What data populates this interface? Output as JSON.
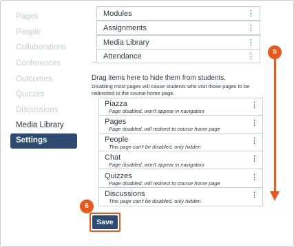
{
  "sidebar": {
    "items": [
      {
        "label": "Pages"
      },
      {
        "label": "People"
      },
      {
        "label": "Collaborations"
      },
      {
        "label": "Conferences"
      },
      {
        "label": "Outcomes"
      },
      {
        "label": "Quizzes"
      },
      {
        "label": "Discussions"
      },
      {
        "label": "Media Library"
      },
      {
        "label": "Settings"
      }
    ]
  },
  "enabled_items": [
    {
      "label": "Modules"
    },
    {
      "label": "Assignments"
    },
    {
      "label": "Media Library"
    },
    {
      "label": "Attendance"
    }
  ],
  "drag_hint": "Drag items here to hide them from students.",
  "drag_hint_small": "Disabling most pages will cause students who visit those pages to be redirected to the course home page.",
  "disabled_items": [
    {
      "name": "Piazza",
      "sub": "Page disabled, won't appear in navigation"
    },
    {
      "name": "Pages",
      "sub": "Page disabled, will redirect to course home page"
    },
    {
      "name": "People",
      "sub": "This page can't be disabled, only hidden"
    },
    {
      "name": "Chat",
      "sub": "Page disabled, won't appear in navigation"
    },
    {
      "name": "Quizzes",
      "sub": "Page disabled, will redirect to course home page"
    },
    {
      "name": "Discussions",
      "sub": "This page can't be disabled, only hidden"
    }
  ],
  "menu_glyph": "⋮",
  "save_label": "Save",
  "callouts": {
    "step5": "5",
    "step6": "6"
  },
  "colors": {
    "accent": "#e8591b",
    "nav_selected": "#2d4a73",
    "text": "#2d3b45",
    "muted": "#c7cdd1"
  }
}
